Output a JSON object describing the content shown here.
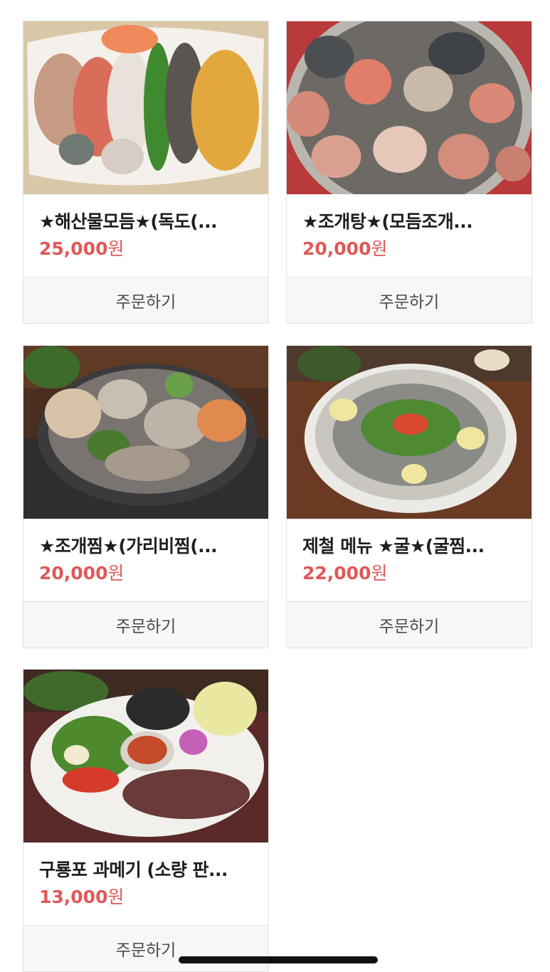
{
  "products": [
    {
      "name": "★해산물모듬★(독도(...",
      "price": "25,000",
      "unit": "원",
      "order_label": "주문하기",
      "image": "seafood-platter-photo"
    },
    {
      "name": "★조개탕★(모듬조개...",
      "price": "20,000",
      "unit": "원",
      "order_label": "주문하기",
      "image": "clam-soup-photo"
    },
    {
      "name": "★조개찜★(가리비찜(...",
      "price": "20,000",
      "unit": "원",
      "order_label": "주문하기",
      "image": "steamed-clams-photo"
    },
    {
      "name": "제철 메뉴 ★굴★(굴찜...",
      "price": "22,000",
      "unit": "원",
      "order_label": "주문하기",
      "image": "oyster-platter-photo"
    },
    {
      "name": "구룡포 과메기 (소량 판...",
      "price": "13,000",
      "unit": "원",
      "order_label": "주문하기",
      "image": "gwamegi-platter-photo"
    }
  ],
  "colors": {
    "price": "#e05858",
    "order_bg": "#f6f7f9",
    "border": "#e3e3e3"
  }
}
